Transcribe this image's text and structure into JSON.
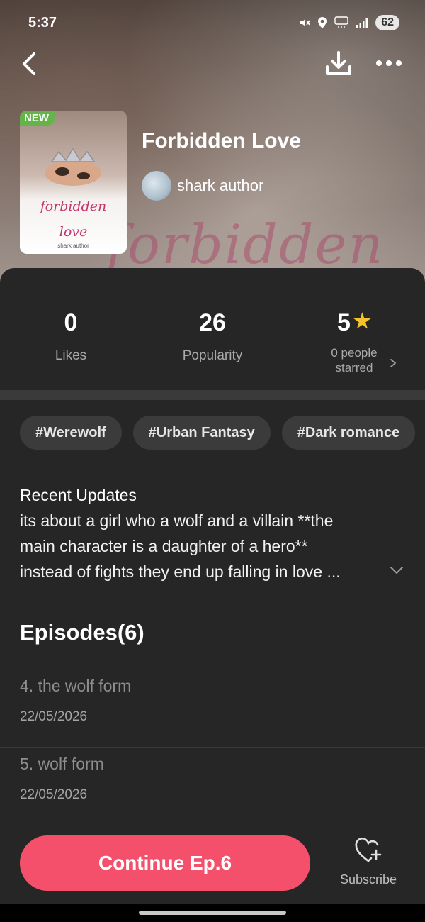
{
  "status_bar": {
    "time": "5:37",
    "battery": "62"
  },
  "book": {
    "badge": "NEW",
    "title": "Forbidden Love",
    "author": "shark author",
    "cover_title_line1": "forbidden",
    "cover_title_line2": "love",
    "cover_author": "shark author",
    "watermark": "forbidden"
  },
  "stats": [
    {
      "value": "0",
      "label": "Likes"
    },
    {
      "value": "26",
      "label": "Popularity"
    },
    {
      "value": "5",
      "label_line1": "0 people",
      "label_line2": "starred"
    }
  ],
  "tags": [
    "#Werewolf",
    "#Urban Fantasy",
    "#Dark romance"
  ],
  "updates": {
    "title": "Recent Updates",
    "line1": "its about a girl who a wolf and a villain **the",
    "line2": "main character is a daughter of a hero**",
    "line3": "instead of fights they end up falling in love  ..."
  },
  "episodes": {
    "header": "Episodes(6)",
    "items": [
      {
        "title": "4. the wolf form",
        "date": "22/05/2026"
      },
      {
        "title": "5. wolf form",
        "date": "22/05/2026"
      }
    ]
  },
  "bottom": {
    "continue_label": "Continue Ep.6",
    "subscribe_label": "Subscribe"
  },
  "colors": {
    "accent": "#f5506b",
    "star": "#f7c12b",
    "new_badge": "#64b44b",
    "panel": "#262626"
  },
  "icons": [
    "back-icon",
    "download-icon",
    "more-icon",
    "star-icon",
    "chevron-right-icon",
    "chevron-down-icon",
    "heart-plus-icon"
  ]
}
